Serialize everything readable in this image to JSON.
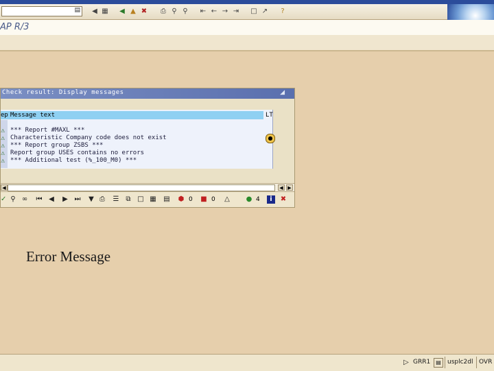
{
  "app": {
    "title": "AP R/3"
  },
  "toolbar": {
    "command_field_value": "",
    "icons": [
      "enter-icon",
      "save-icon",
      "back-icon",
      "exit-icon",
      "cancel-icon",
      "print-icon",
      "find-icon",
      "find-next-icon",
      "first-page-icon",
      "prev-page-icon",
      "next-page-icon",
      "last-page-icon",
      "new-session-icon",
      "shortcut-icon",
      "help-icon"
    ]
  },
  "dialog": {
    "title": "Check result: Display messages",
    "header": {
      "prefix": "ep",
      "text": "Message text",
      "right": "LT"
    },
    "rows": [
      {
        "icon": "⚠",
        "text": "*** Report #MAXL ***"
      },
      {
        "icon": "⚠",
        "text": "Characteristic Company code does not exist"
      },
      {
        "icon": "⚠",
        "text": "*** Report group ZSBS ***"
      },
      {
        "icon": "⚠",
        "text": "Report group USES contains no errors"
      },
      {
        "icon": "⚠",
        "text": "*** Additional test (%_100_M0) ***"
      }
    ],
    "counts": {
      "errors": "0",
      "stop": "0",
      "warnings": "",
      "ok": "4"
    }
  },
  "caption": "Error Message",
  "statusbar": {
    "system": "GRR1",
    "server": "usplc2dl",
    "mode": "OVR"
  },
  "colors": {
    "background": "#e6cfac",
    "dialog_title": "#5a6fae",
    "header_row": "#8fd0f2"
  }
}
